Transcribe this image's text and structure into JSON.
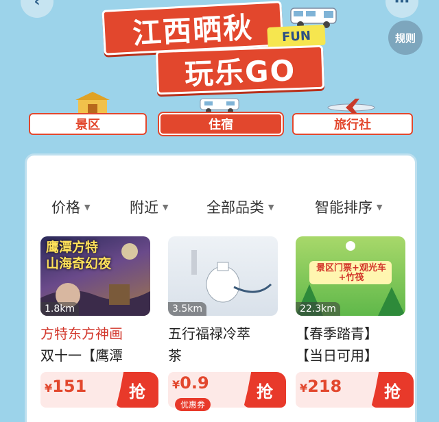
{
  "banner": {
    "line1": "江西晒秋",
    "line2": "玩乐GO",
    "fun_tag": "FUN"
  },
  "rules_label": "规则",
  "tabs": [
    {
      "label": "景区",
      "active": false
    },
    {
      "label": "住宿",
      "active": true
    },
    {
      "label": "旅行社",
      "active": false
    }
  ],
  "filters": [
    {
      "label": "价格"
    },
    {
      "label": "附近"
    },
    {
      "label": "全部品类"
    },
    {
      "label": "智能排序"
    }
  ],
  "products": [
    {
      "thumb_text": "鹰潭方特\n山海奇幻夜",
      "distance": "1.8km",
      "title_line1": "方特东方神画",
      "title_line2": "双十一【鹰潭",
      "price_symbol": "¥",
      "price": "151",
      "buy_label": "抢"
    },
    {
      "thumb_text": "",
      "distance": "3.5km",
      "title_line1": "五行福禄冷萃",
      "title_line2": "茶",
      "price_symbol": "¥",
      "price": "0.9",
      "coupon": "优惠券",
      "buy_label": "抢"
    },
    {
      "thumb_text": "景区门票+观光车+竹筏",
      "distance": "22.3km",
      "title_line1": "【春季踏青】",
      "title_line2": "【当日可用】",
      "price_symbol": "¥",
      "price": "218",
      "buy_label": "抢"
    }
  ],
  "colors": {
    "background": "#9cd3ea",
    "accent": "#e2472d",
    "fun_yellow": "#f6e64f"
  }
}
